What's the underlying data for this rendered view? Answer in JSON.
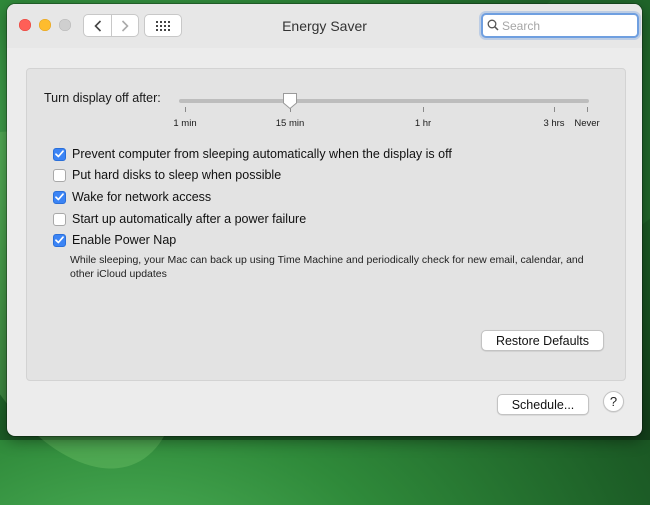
{
  "window": {
    "title": "Energy Saver"
  },
  "search": {
    "placeholder": "Search",
    "value": ""
  },
  "display_sleep": {
    "label": "Turn display off after:",
    "value": "15 min",
    "ticks": [
      "1 min",
      "15 min",
      "1 hr",
      "3 hrs",
      "Never"
    ]
  },
  "options": [
    {
      "label": "Prevent computer from sleeping automatically when the display is off",
      "checked": true
    },
    {
      "label": "Put hard disks to sleep when possible",
      "checked": false
    },
    {
      "label": "Wake for network access",
      "checked": true
    },
    {
      "label": "Start up automatically after a power failure",
      "checked": false
    },
    {
      "label": "Enable Power Nap",
      "checked": true,
      "description": "While sleeping, your Mac can back up using Time Machine and periodically check for new email, calendar, and other iCloud updates"
    }
  ],
  "buttons": {
    "restore_defaults": "Restore Defaults",
    "schedule": "Schedule...",
    "help": "?"
  },
  "colors": {
    "checkbox_on": "#3b84f5",
    "search_focus": "#6f9fe0"
  }
}
